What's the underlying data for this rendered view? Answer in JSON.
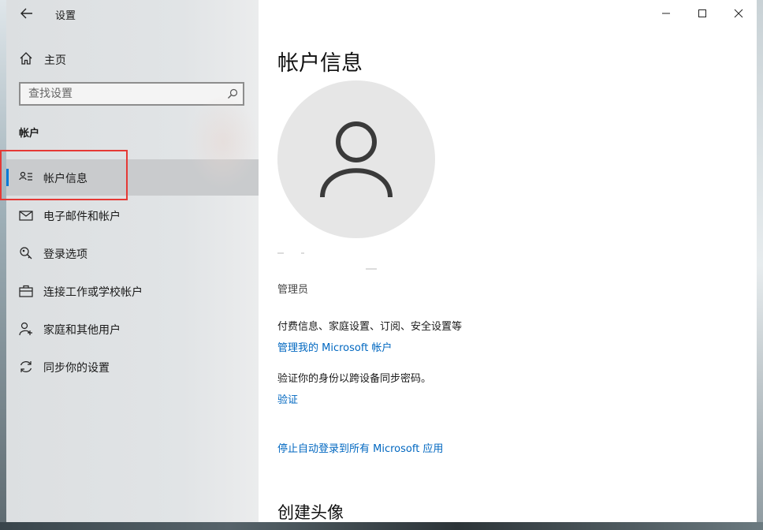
{
  "window": {
    "title": "设置",
    "caption": {
      "minimize": "minimize",
      "maximize": "maximize",
      "close": "close"
    }
  },
  "sidebar": {
    "home_label": "主页",
    "search_placeholder": "查找设置",
    "section_title": "帐户",
    "items": [
      {
        "label": "帐户信息",
        "icon": "account-info-icon",
        "active": true
      },
      {
        "label": "电子邮件和帐户",
        "icon": "mail-icon",
        "active": false
      },
      {
        "label": "登录选项",
        "icon": "key-icon",
        "active": false
      },
      {
        "label": "连接工作或学校帐户",
        "icon": "briefcase-icon",
        "active": false
      },
      {
        "label": "家庭和其他用户",
        "icon": "person-add-icon",
        "active": false
      },
      {
        "label": "同步你的设置",
        "icon": "sync-icon",
        "active": false
      }
    ]
  },
  "main": {
    "title": "帐户信息",
    "role": "管理员",
    "billing_text": "付费信息、家庭设置、订阅、安全设置等",
    "manage_link": "管理我的 Microsoft 帐户",
    "verify_text": "验证你的身份以跨设备同步密码。",
    "verify_link": "验证",
    "stop_signin_link": "停止自动登录到所有 Microsoft 应用",
    "create_avatar_title": "创建头像"
  },
  "colors": {
    "accent": "#0078d7",
    "link": "#0067c0",
    "highlight_box": "#e53935"
  }
}
